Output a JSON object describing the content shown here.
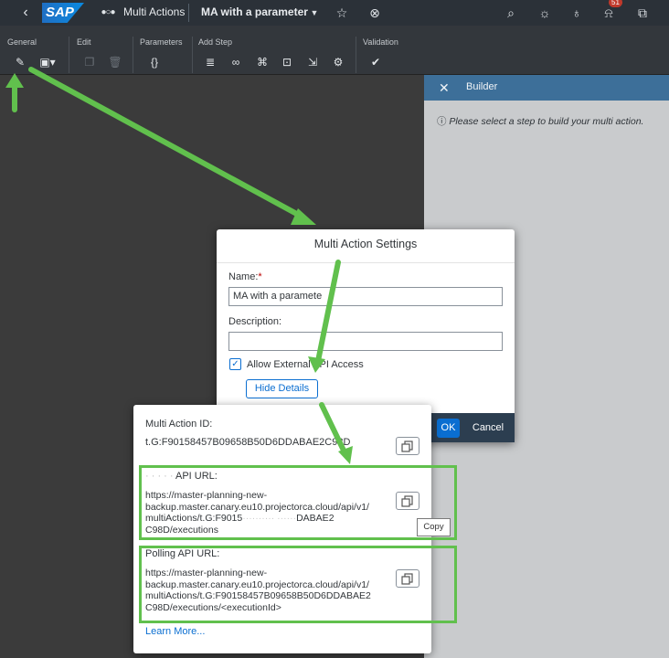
{
  "shell": {
    "logo": "SAP",
    "app_name": "Multi Actions",
    "doc_title": "MA with a parameter",
    "notification_count": "51",
    "icons": [
      "back-icon",
      "multi-action-icon",
      "chevron-down-icon",
      "star-icon",
      "close-circle-icon",
      "search-icon",
      "lightbulb-settings-icon",
      "lightbulb-icon",
      "bell-icon",
      "chat-icon"
    ]
  },
  "toolbar": {
    "groups": {
      "general": "General",
      "edit": "Edit",
      "parameters": "Parameters",
      "add_step": "Add Step",
      "validation": "Validation"
    },
    "icons": {
      "settings": "wrench-icon",
      "save": "save-icon",
      "copy": "copy-icon",
      "delete": "trash-icon",
      "parameters": "braces-icon",
      "data_action": "data-action-icon",
      "binoculars": "binoculars-icon",
      "predictive": "predictive-icon",
      "lock": "lock-icon",
      "import": "import-icon",
      "api": "api-icon",
      "validate": "check-circle-icon"
    }
  },
  "builder": {
    "title": "Builder",
    "message": "Please select a step to build your multi action."
  },
  "dialog": {
    "title": "Multi Action Settings",
    "name_label": "Name:",
    "required_mark": "*",
    "name_value": "MA with a paramete",
    "description_label": "Description:",
    "description_value": "",
    "allow_api_label": "Allow External API Access",
    "allow_api_checked": true,
    "hide_details": "Hide Details",
    "ok": "OK",
    "cancel": "Cancel"
  },
  "popover": {
    "id_label": "Multi Action ID:",
    "id_value": "t.G:F90158457B09658B50D6DDABAE2C98D",
    "start_label": "API URL:",
    "start_url": [
      "https://master-planning-new-",
      "backup.master.canary.eu10.projectorca.cloud/api/v1/",
      "multiActions/t.G:F9015",
      "DABAE2",
      "C98D/executions"
    ],
    "polling_label": "Polling API URL:",
    "polling_url": [
      "https://master-planning-new-",
      "backup.master.canary.eu10.projectorca.cloud/api/v1/",
      "multiActions/t.G:F90158457B09658B50D6DDABAE2",
      "C98D/executions/<executionId>"
    ],
    "copy_tooltip": "Copy",
    "learn_more": "Learn More..."
  },
  "colors": {
    "shell_bg": "#2b3138",
    "builder_header": "#3d6f99",
    "accent": "#0a6ed1",
    "annotation": "#61c04d"
  }
}
